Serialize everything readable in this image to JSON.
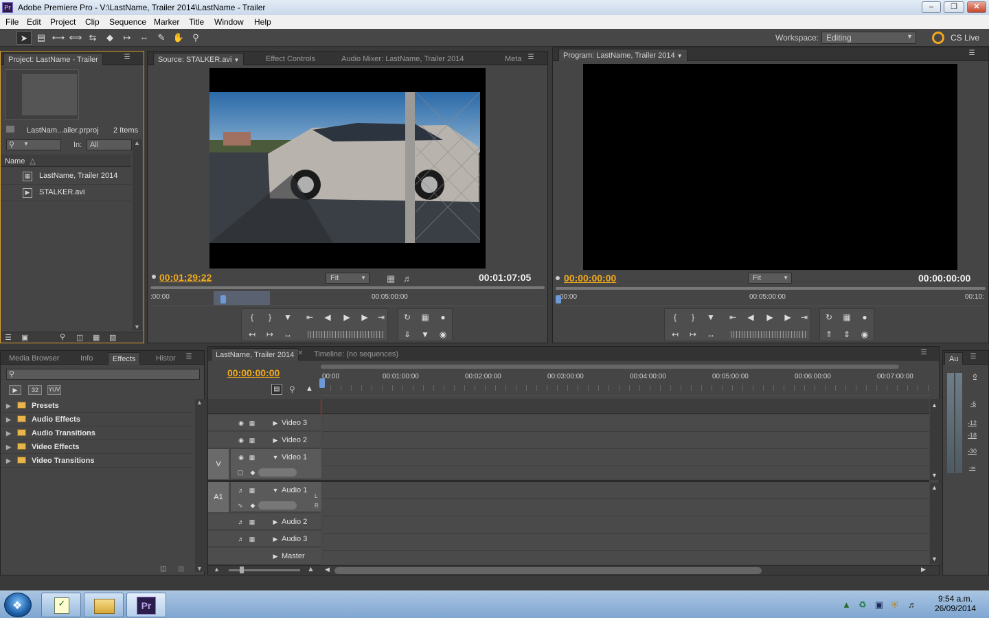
{
  "window": {
    "title": "Adobe Premiere Pro - V:\\LastName, Trailer 2014\\LastName - Trailer",
    "app_icon": "Pr"
  },
  "menu": [
    "File",
    "Edit",
    "Project",
    "Clip",
    "Sequence",
    "Marker",
    "Title",
    "Window",
    "Help"
  ],
  "workspace": {
    "label": "Workspace:",
    "value": "Editing",
    "cs_live": "CS Live"
  },
  "project": {
    "tab": "Project: LastName - Trailer",
    "filename": "LastNam...ailer.prproj",
    "count": "2 Items",
    "in_label": "In:",
    "in_value": "All",
    "col_name": "Name",
    "items": [
      "LastName, Trailer 2014",
      "STALKER.avi"
    ]
  },
  "source": {
    "tabs": [
      "Source: STALKER.avi",
      "Effect Controls",
      "Audio Mixer: LastName, Trailer 2014",
      "Meta"
    ],
    "tc_current": "00:01:29:22",
    "fit": "Fit",
    "tc_duration": "00:01:07:05",
    "ruler": [
      ":00:00",
      "00:05:00:00"
    ]
  },
  "program": {
    "tab": "Program: LastName, Trailer 2014",
    "tc_current": "00:00:00:00",
    "fit": "Fit",
    "tc_duration": "00:00:00:00",
    "ruler": [
      "00:00",
      "00:05:00:00",
      "00:10:"
    ]
  },
  "effects": {
    "tabs": [
      "Media Browser",
      "Info",
      "Effects",
      "Histor"
    ],
    "badges": [
      "32",
      "YUV"
    ],
    "items": [
      "Presets",
      "Audio Effects",
      "Audio Transitions",
      "Video Effects",
      "Video Transitions"
    ]
  },
  "timeline": {
    "tabs": [
      "LastName, Trailer 2014",
      "Timeline: (no sequences)"
    ],
    "tc": "00:00:00:00",
    "ruler": [
      "00:00",
      "00:01:00:00",
      "00:02:00:00",
      "00:03:00:00",
      "00:04:00:00",
      "00:05:00:00",
      "00:06:00:00",
      "00:07:00:00"
    ],
    "video_tracks": [
      "Video 3",
      "Video 2",
      "Video 1"
    ],
    "audio_tracks": [
      "Audio 1",
      "Audio 2",
      "Audio 3",
      "Master"
    ],
    "v_target": "V",
    "a_target": "A1",
    "lr": [
      "L",
      "R"
    ]
  },
  "audio_meter": {
    "tab": "Au",
    "scale": [
      "0",
      "-6",
      "-12",
      "-18",
      "-30",
      "-∞"
    ]
  },
  "taskbar": {
    "time": "9:54 a.m.",
    "date": "26/09/2014",
    "pr_label": "Pr"
  }
}
